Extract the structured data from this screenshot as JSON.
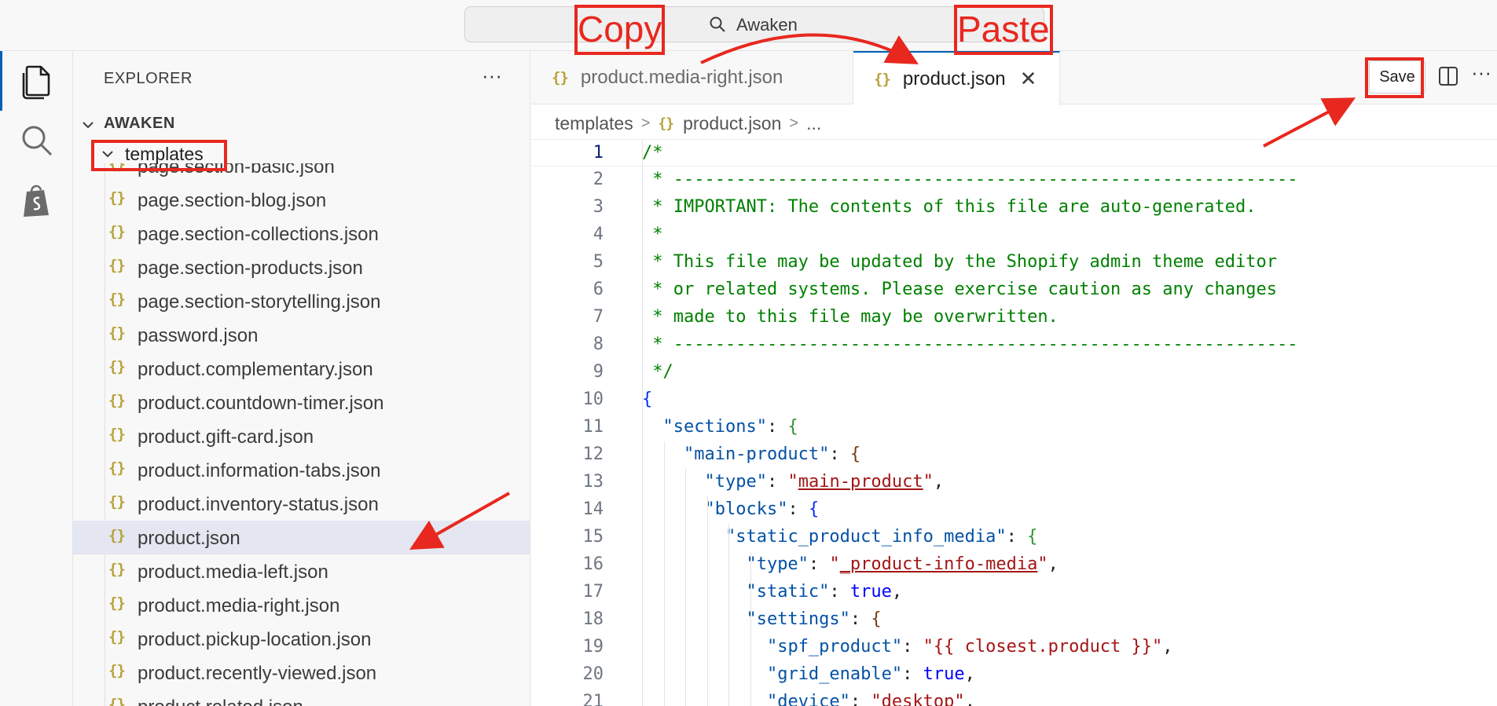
{
  "titlebar": {
    "command_center_text": "Awaken"
  },
  "activity_bar": {
    "items": [
      {
        "name": "explorer",
        "icon": "files-icon",
        "active": true
      },
      {
        "name": "search",
        "icon": "search-icon",
        "active": false
      },
      {
        "name": "shopify",
        "icon": "shopify-bag-icon",
        "active": false
      }
    ]
  },
  "sidebar": {
    "title": "EXPLORER",
    "more_label": "···",
    "root_folder": "AWAKEN",
    "subfolder": "templates",
    "files": [
      "page.section-basic.json",
      "page.section-blog.json",
      "page.section-collections.json",
      "page.section-products.json",
      "page.section-storytelling.json",
      "password.json",
      "product.complementary.json",
      "product.countdown-timer.json",
      "product.gift-card.json",
      "product.information-tabs.json",
      "product.inventory-status.json",
      "product.json",
      "product.media-left.json",
      "product.media-right.json",
      "product.pickup-location.json",
      "product.recently-viewed.json",
      "product.related.json"
    ],
    "selected_file": "product.json"
  },
  "editor": {
    "tabs": [
      {
        "label": "product.media-right.json",
        "icon": "{}",
        "active": false
      },
      {
        "label": "product.json",
        "icon": "{}",
        "active": true,
        "close": "✕"
      }
    ],
    "save_label": "Save",
    "more_label": "···",
    "breadcrumb": {
      "folder": "templates",
      "file": "product.json",
      "tail": "..."
    },
    "current_line": 1,
    "lines": [
      "/*",
      " * ------------------------------------------------------------",
      " * IMPORTANT: The contents of this file are auto-generated.",
      " *",
      " * This file may be updated by the Shopify admin theme editor",
      " * or related systems. Please exercise caution as any changes",
      " * made to this file may be overwritten.",
      " * ------------------------------------------------------------",
      " */",
      "{",
      "  \"sections\": {",
      "    \"main-product\": {",
      "      \"type\": \"main-product\",",
      "      \"blocks\": {",
      "        \"static_product_info_media\": {",
      "          \"type\": \"_product-info-media\",",
      "          \"static\": true,",
      "          \"settings\": {",
      "            \"spf_product\": \"{{ closest.product }}\",",
      "            \"grid_enable\": true,",
      "            \"device\": \"desktop\","
    ]
  },
  "annotations": {
    "copy_label": "Copy",
    "paste_label": "Paste",
    "color": "#e8281f"
  }
}
